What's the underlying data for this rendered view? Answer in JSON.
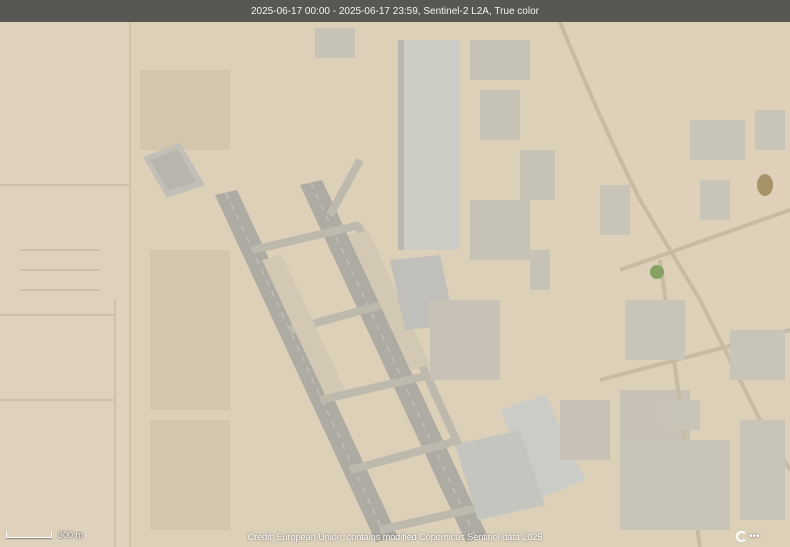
{
  "header": {
    "caption": "2025-06-17 00:00 - 2025-06-17 23:59, Sentinel-2 L2A, True color"
  },
  "scale": {
    "label": "300 m"
  },
  "attribution": {
    "text": "Credit: European Union, contains modified Copernicus Sentinel data 2025"
  },
  "logo": {
    "icon": "sentinel-hub-logo-icon"
  },
  "colors": {
    "desert": "#d9ccb4",
    "runway": "#a5a39a",
    "taxiway": "#b8b3a6",
    "roof": "#c9c9c2",
    "road": "#c4b69c",
    "vegetation": "#7e9a55",
    "topbar": "#464646"
  }
}
